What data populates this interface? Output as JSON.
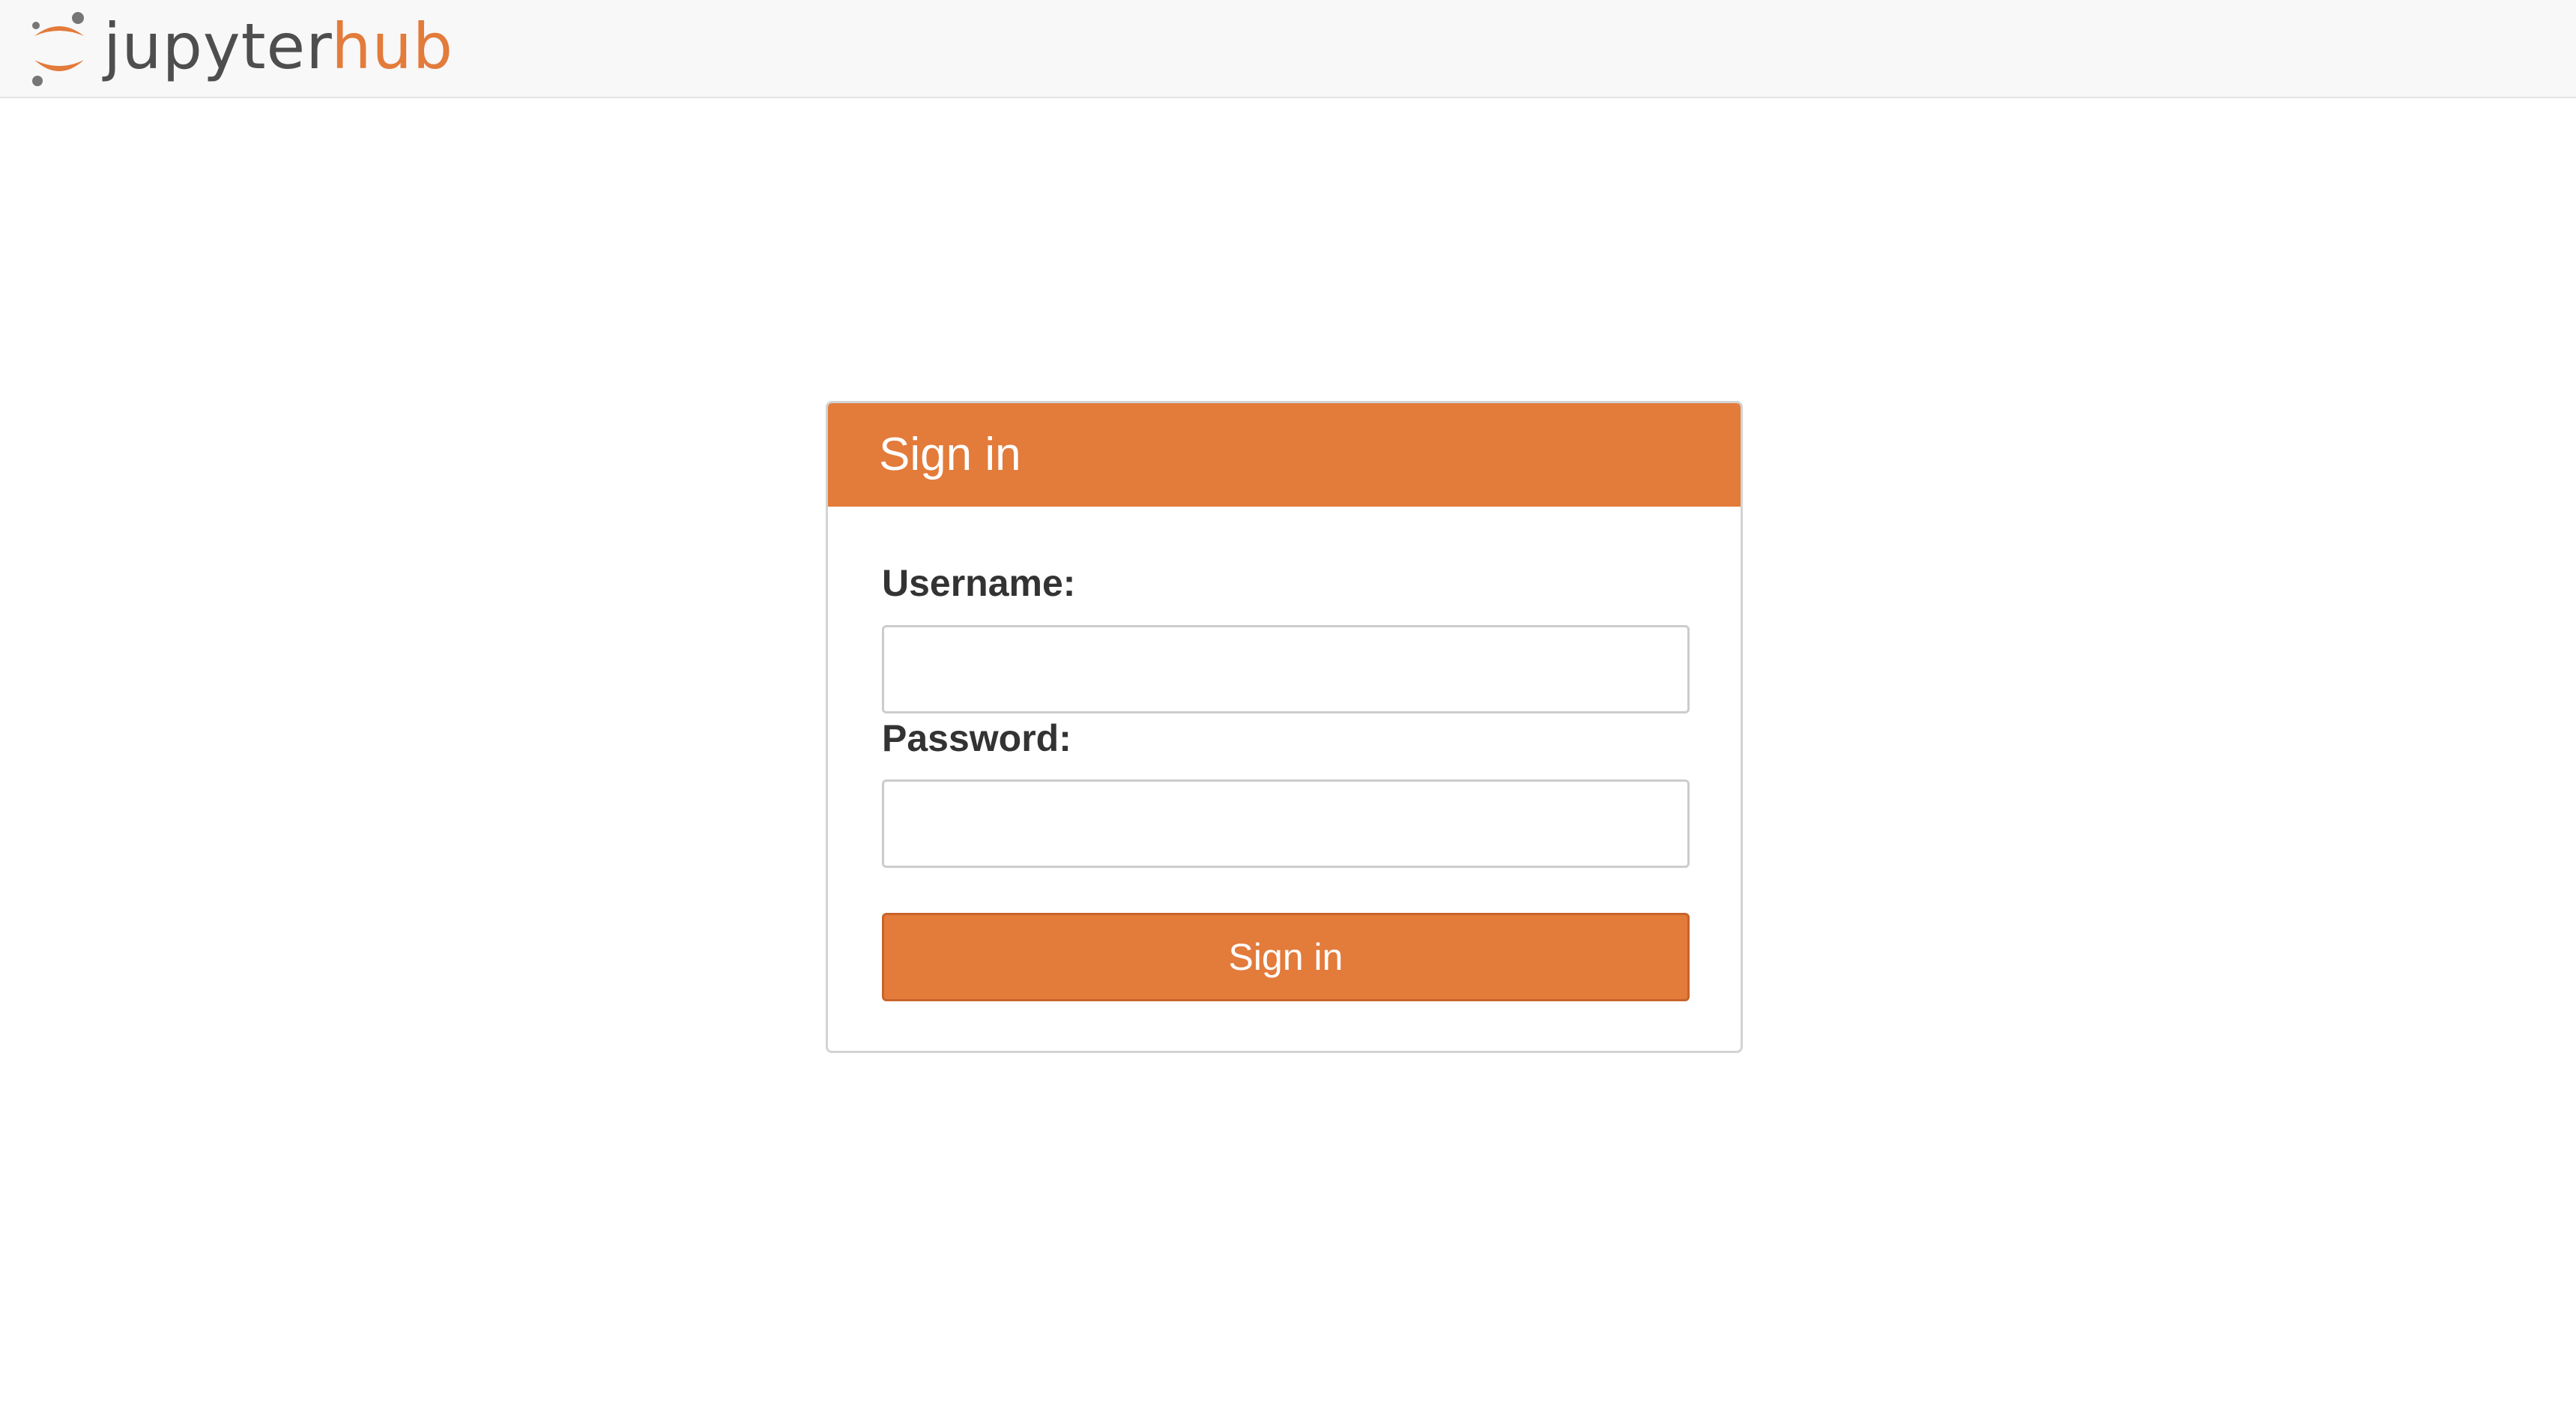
{
  "header": {
    "logo": {
      "text_primary": "jupyter",
      "text_accent": "hub",
      "icon": "jupyter-logo-icon"
    }
  },
  "login": {
    "title": "Sign in",
    "username_label": "Username:",
    "username_value": "",
    "password_label": "Password:",
    "password_value": "",
    "submit_label": "Sign in"
  },
  "colors": {
    "accent": "#e37b3b",
    "header_bg": "#f8f8f8",
    "text_dark": "#333333",
    "logo_gray": "#4e4e4e"
  }
}
